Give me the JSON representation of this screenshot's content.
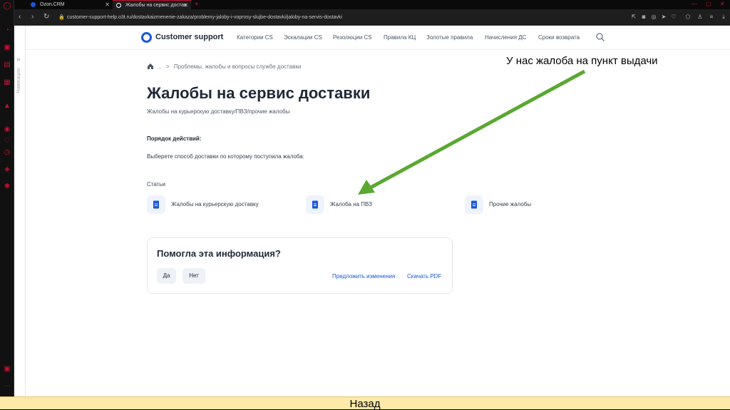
{
  "browser": {
    "tabs": [
      {
        "label": "Ozon.CRM",
        "active": false
      },
      {
        "label": "Жалобы на сервис достав",
        "active": true
      }
    ],
    "new_tab_symbol": "+",
    "url": "customer-support-help.o3t.ru/dostavkaizmenenie-zakaza/problemy-jaloby-i-voprosy-slujbe-dostavki/jaloby-na-servis-dostavki"
  },
  "site": {
    "logo_text": "Customer support",
    "brand_color": "#1a56db",
    "menu": [
      "Категории CS",
      "Эскалации CS",
      "Резолюции CS",
      "Правила КЦ",
      "Золотые правила",
      "Начисления ДС",
      "Сроки возврата"
    ],
    "rail_label": "Навигация"
  },
  "breadcrumb": {
    "ellipsis": "...",
    "separator": ">",
    "current": "Проблемы, жалобы и вопросы службе доставки"
  },
  "main": {
    "title": "Жалобы на сервис доставки",
    "subtitle": "Жалобы на курьерскую доставку/ПВЗ/прочие жалобы",
    "steps_title": "Порядок действий:",
    "steps_text": "Выберете способ доставки по которому поступила жалоба:",
    "articles_label": "Статьи",
    "articles": [
      {
        "label": "Жалобы на курьерскую доставку"
      },
      {
        "label": "Жалоба на ПВЗ"
      },
      {
        "label": "Прочие жалобы"
      }
    ]
  },
  "feedback": {
    "title": "Помогла эта информация?",
    "yes": "Да",
    "no": "Нет",
    "suggest": "Предложить изменения",
    "pdf": "Скачать PDF"
  },
  "annotation": {
    "text": "У нас жалоба на пункт выдачи",
    "arrow_color": "#5aa832"
  },
  "footer": {
    "back": "Назад"
  }
}
